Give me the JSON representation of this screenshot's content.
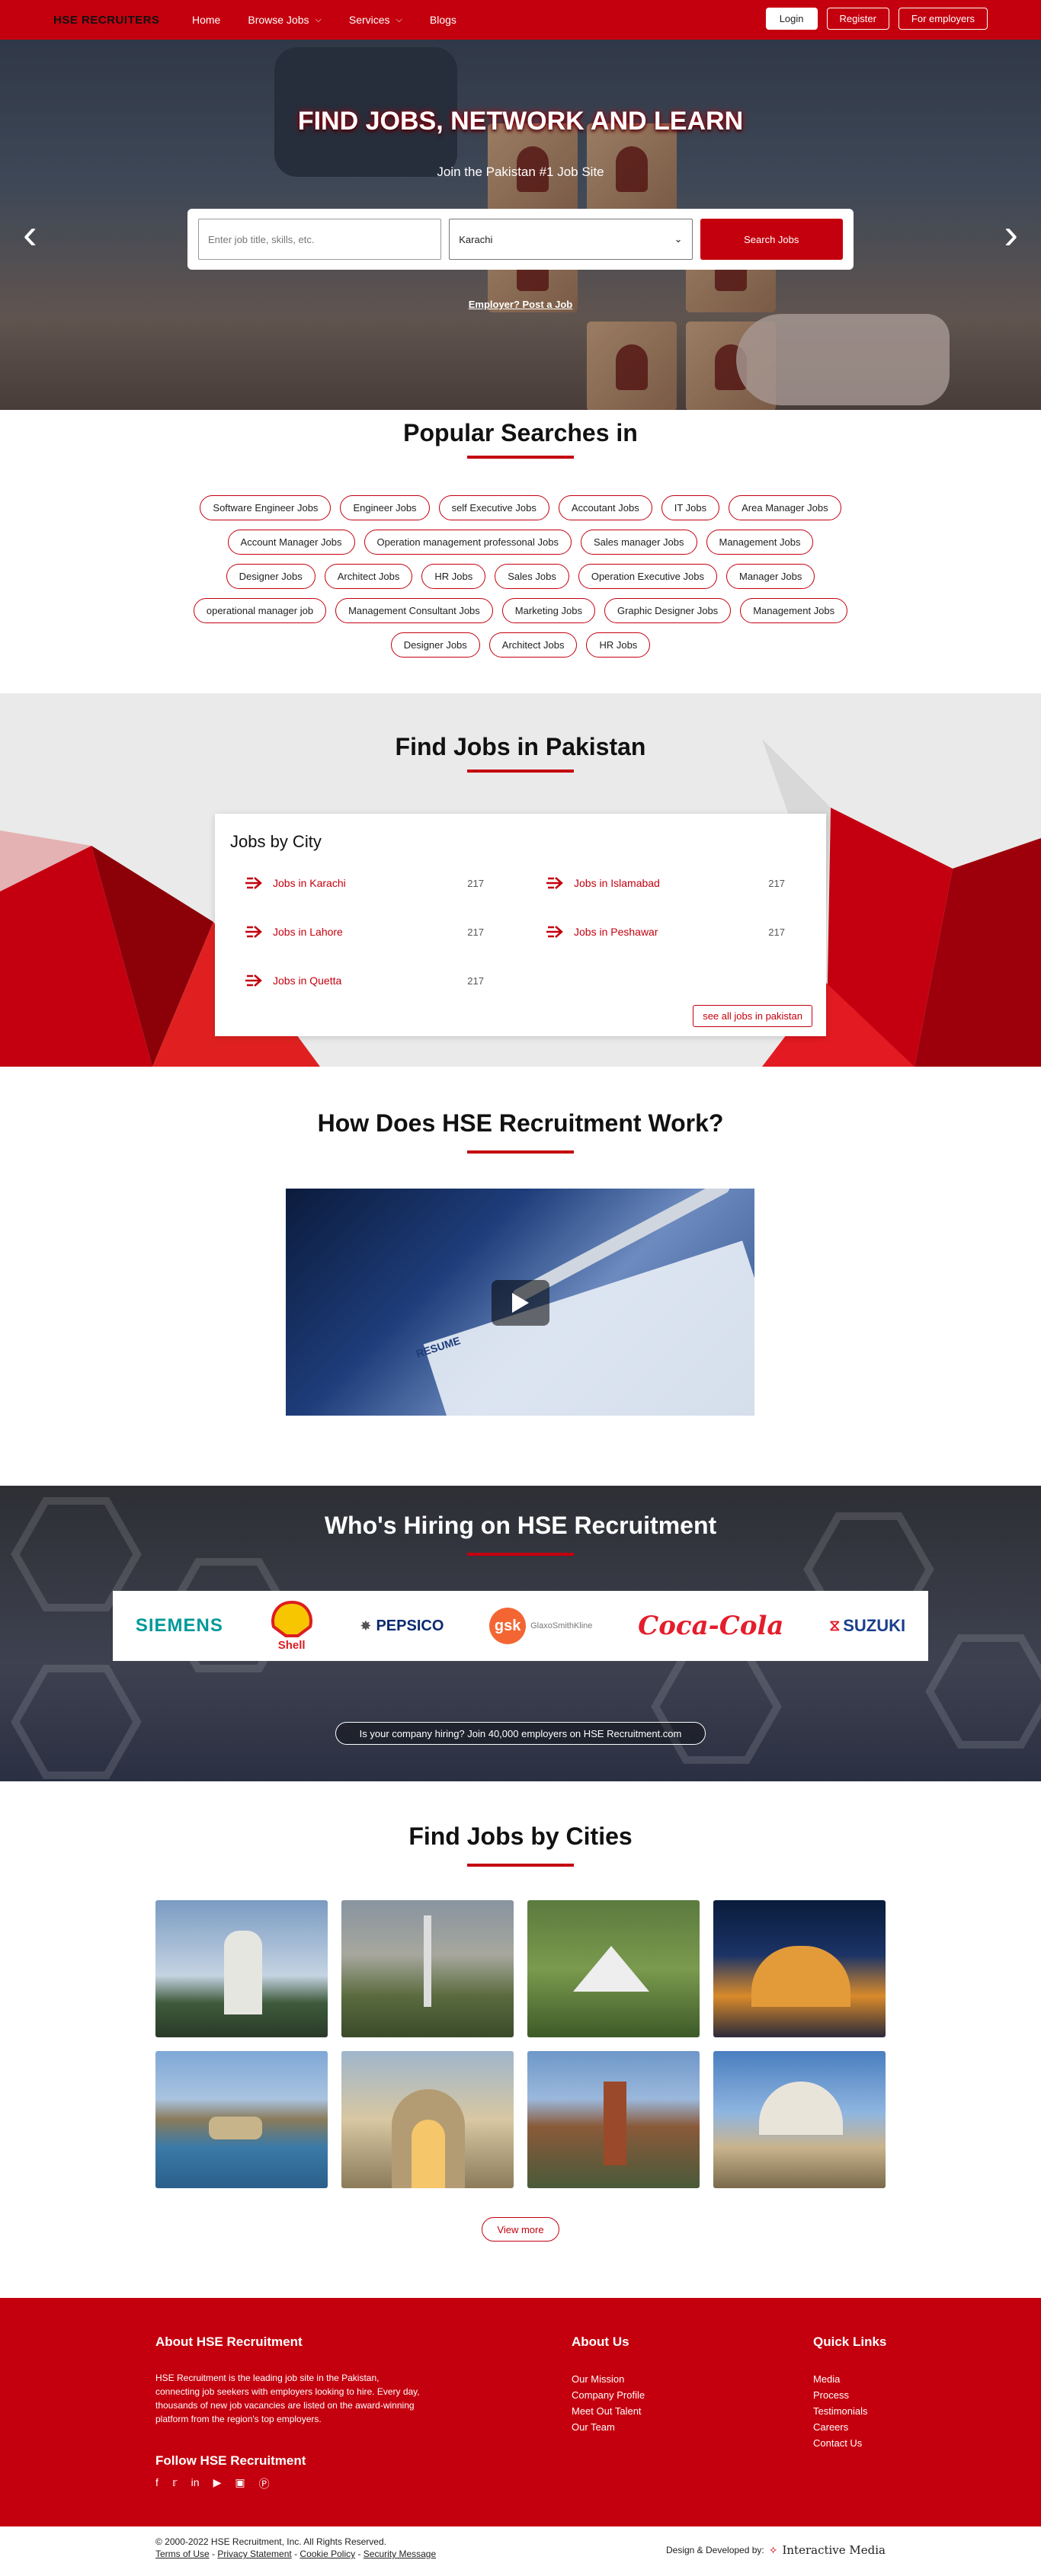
{
  "nav": {
    "logo": "HSE RECRUITERS",
    "items": [
      "Home",
      "Browse Jobs",
      "Services",
      "Blogs"
    ],
    "login": "Login",
    "register": "Register",
    "employers": "For employers"
  },
  "hero": {
    "title": "FIND JOBS, NETWORK AND LEARN",
    "subtitle": "Join the Pakistan #1 Job Site",
    "keyword_placeholder": "Enter job title, skills, etc.",
    "city_value": "Karachi",
    "search_button": "Search Jobs",
    "employer_link": "Employer? Post a Job"
  },
  "popular": {
    "title": "Popular Searches in",
    "tags": [
      "Software Engineer Jobs",
      "Engineer Jobs",
      "self Executive Jobs",
      "Accoutant Jobs",
      "IT Jobs",
      "Area Manager Jobs",
      "Account Manager Jobs",
      "Operation management professonal Jobs",
      "Sales manager Jobs",
      "Management Jobs",
      "Designer Jobs",
      "Architect Jobs",
      "HR Jobs",
      "Sales Jobs",
      "Operation Executive Jobs",
      "Manager Jobs",
      "operational manager job",
      "Management Consultant Jobs",
      "Marketing Jobs",
      "Graphic Designer Jobs",
      "Management Jobs",
      "Designer Jobs",
      "Architect Jobs",
      "HR Jobs"
    ]
  },
  "pakistan": {
    "title": "Find Jobs in Pakistan",
    "card_title": "Jobs by City",
    "cities": [
      {
        "label": "Jobs in Karachi",
        "count": "217"
      },
      {
        "label": "Jobs in Islamabad",
        "count": "217"
      },
      {
        "label": "Jobs in Lahore",
        "count": "217"
      },
      {
        "label": "Jobs in Peshawar",
        "count": "217"
      },
      {
        "label": "Jobs in Quetta",
        "count": "217"
      }
    ],
    "see_all": "see all jobs in pakistan"
  },
  "how": {
    "title": "How Does HSE Recruitment Work?",
    "video_label": "RESUME"
  },
  "hiring": {
    "title": "Who's Hiring on HSE Recruitment",
    "logos": [
      "SIEMENS",
      "Shell",
      "PEPSICO",
      "gsk",
      "GlaxoSmithKline",
      "Coca-Cola",
      "SUZUKI"
    ],
    "cta": "Is your company hiring? Join 40,000 employers on HSE Recruitment.com"
  },
  "cities_section": {
    "title": "Find Jobs by Cities",
    "view_more": "View more"
  },
  "footer": {
    "about_title": "About HSE Recruitment",
    "about_text": "HSE Recruitment is the leading job site in the Pakistan, connecting job seekers with employers looking to hire. Every day, thousands of new job vacancies are listed on the award-winning platform from the region's top employers.",
    "follow_title": "Follow HSE Recruitment",
    "about_us_title": "About Us",
    "about_us_links": [
      "Our Mission",
      "Company Profile",
      "Meet Out Talent",
      "Our Team"
    ],
    "quick_title": "Quick Links",
    "quick_links": [
      "Media",
      "Process",
      "Testimonials",
      "Careers",
      "Contact Us"
    ],
    "copyright": "© 2000-2022 HSE Recruitment, Inc. All Rights Reserved.",
    "legal_links": [
      "Terms of Use",
      "Privacy Statement",
      "Cookie Policy",
      "Security Message"
    ],
    "designed_by": "Design & Developed by:",
    "designer": "Interactive Media"
  },
  "colors": {
    "accent": "#c4000e"
  }
}
